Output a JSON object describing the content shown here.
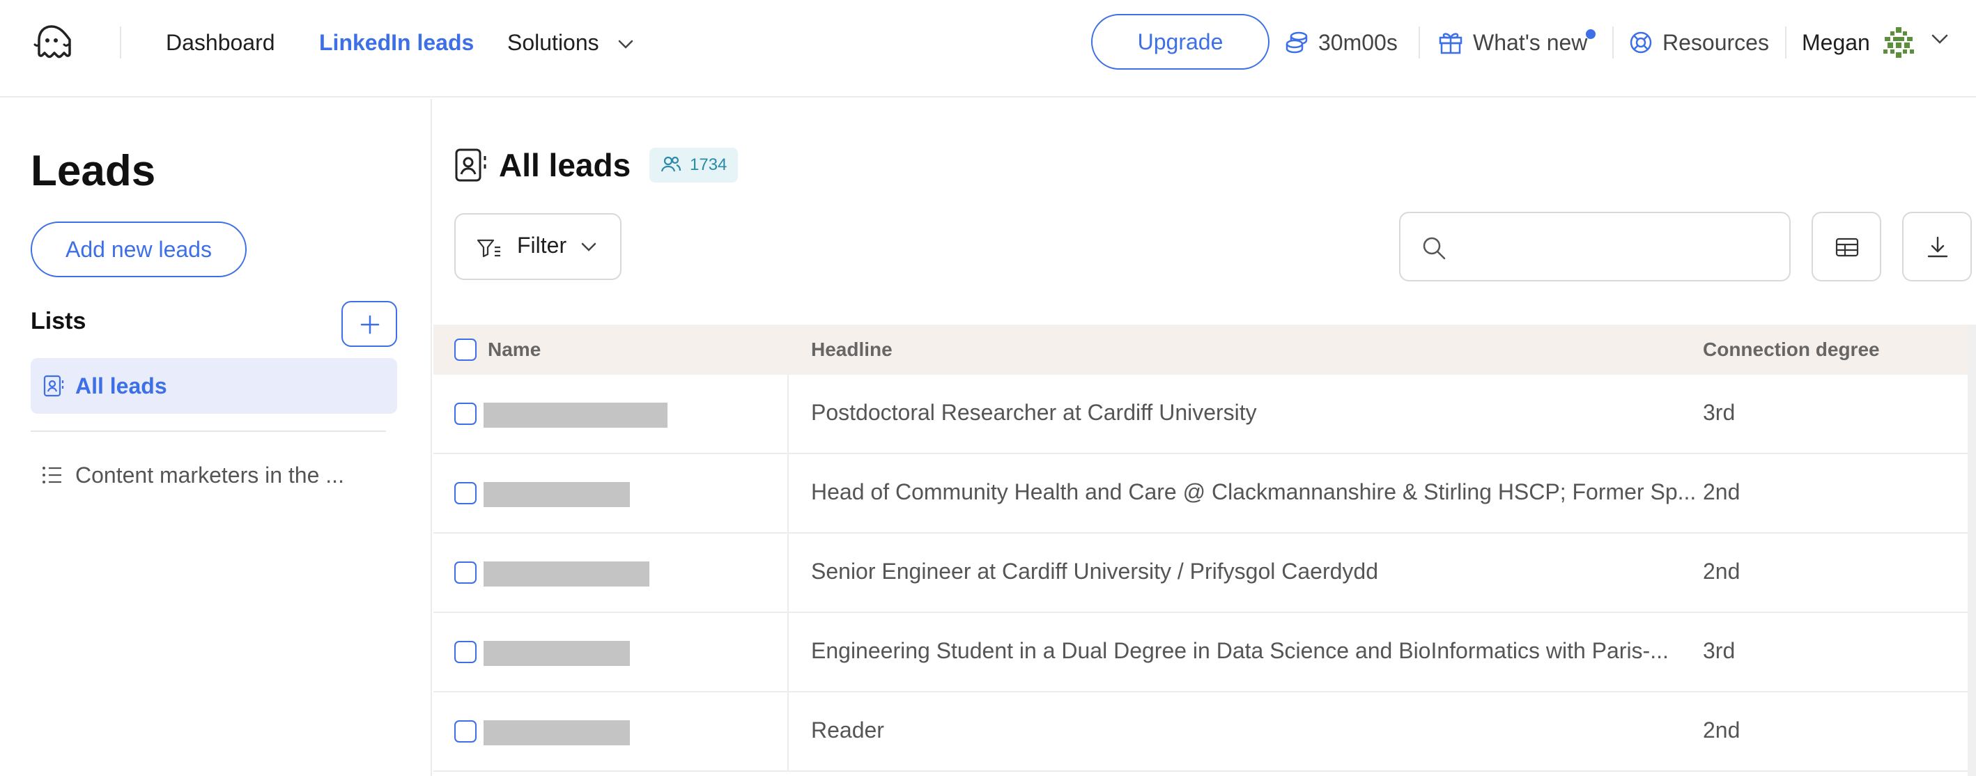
{
  "nav": {
    "dashboard": "Dashboard",
    "linkedin_leads": "LinkedIn leads",
    "solutions": "Solutions",
    "upgrade": "Upgrade",
    "credits": "30m00s",
    "whats_new": "What's new",
    "resources": "Resources",
    "user_name": "Megan"
  },
  "sidebar": {
    "title": "Leads",
    "add_leads": "Add new leads",
    "lists_label": "Lists",
    "lists": [
      {
        "label": "All leads"
      },
      {
        "label": "Content marketers in the ..."
      }
    ]
  },
  "main": {
    "title": "All leads",
    "count": "1734",
    "filter_label": "Filter",
    "search_placeholder": ""
  },
  "table": {
    "columns": [
      "Name",
      "Headline",
      "Connection degree"
    ],
    "rows": [
      {
        "headline": "Postdoctoral Researcher at Cardiff University",
        "degree": "3rd"
      },
      {
        "headline": "Head of Community Health and Care @ Clackmannanshire & Stirling HSCP; Former Sp...",
        "degree": "2nd"
      },
      {
        "headline": "Senior Engineer at Cardiff University / Prifysgol Caerdydd",
        "degree": "2nd"
      },
      {
        "headline": "Engineering Student in a Dual Degree in Data Science and BioInformatics with Paris-...",
        "degree": "3rd"
      },
      {
        "headline": "Reader",
        "degree": "2nd"
      }
    ]
  },
  "colors": {
    "accent": "#3d6fe6",
    "selected_bg": "#e8ecfb",
    "table_header_bg": "#f6f0ed",
    "badge_bg": "#e6f4f7",
    "badge_text": "#2a8aa8"
  }
}
